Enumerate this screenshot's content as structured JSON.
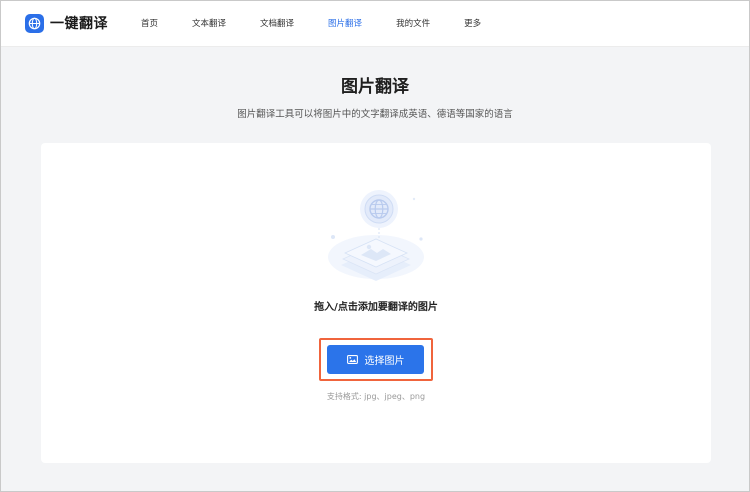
{
  "brand": {
    "name": "一键翻译"
  },
  "nav": {
    "items": [
      {
        "label": "首页",
        "active": false
      },
      {
        "label": "文本翻译",
        "active": false
      },
      {
        "label": "文档翻译",
        "active": false
      },
      {
        "label": "图片翻译",
        "active": true
      },
      {
        "label": "我的文件",
        "active": false
      },
      {
        "label": "更多",
        "active": false
      }
    ]
  },
  "page": {
    "title": "图片翻译",
    "subtitle": "图片翻译工具可以将图片中的文字翻译成英语、德语等国家的语言"
  },
  "upload": {
    "drop_text": "拖入/点击添加要翻译的图片",
    "button_label": "选择图片",
    "formats_text": "支持格式: jpg、jpeg、png"
  },
  "colors": {
    "accent": "#2b74ea",
    "highlight": "#f0643c"
  }
}
